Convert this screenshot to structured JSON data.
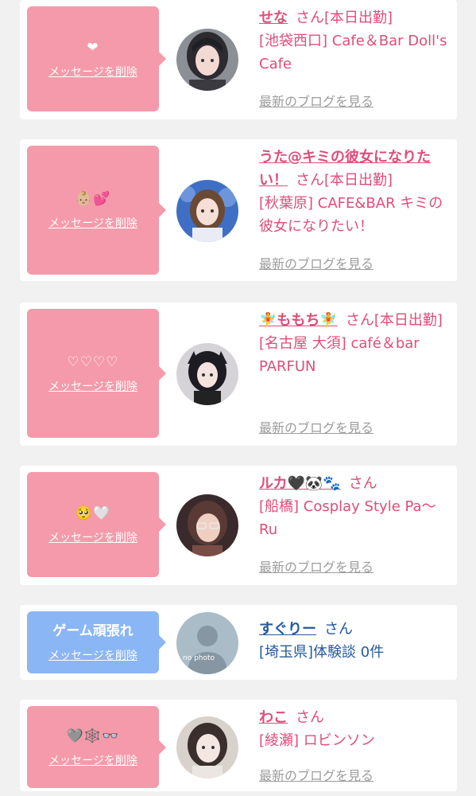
{
  "messages": [
    {
      "message": "❤",
      "delete_label": "メッセージを削除",
      "avatar": "girl-photo-1",
      "name": "せな",
      "suffix": "さん[本日出勤]",
      "shop": "[池袋西口] Cafe＆Bar Doll's Cafe",
      "blog_label": "最新のブログを見る"
    },
    {
      "message": "👶🏼💕",
      "delete_label": "メッセージを削除",
      "avatar": "girl-photo-2",
      "name": "うた@キミの彼女になりたい！",
      "suffix": "さん[本日出勤]",
      "shop": "[秋葉原] CAFE&BAR キミの彼女になりたい！",
      "blog_label": "最新のブログを見る"
    },
    {
      "message": "♡♡♡♡",
      "delete_label": "メッセージを削除",
      "avatar": "girl-photo-3",
      "name": "🧚ももち🧚",
      "suffix": "さん[本日出勤]",
      "shop": "[名古屋 大須] café＆bar PARFUN",
      "blog_label": "最新のブログを見る"
    },
    {
      "message": "🥺🤍",
      "delete_label": "メッセージを削除",
      "avatar": "girl-photo-4",
      "name": "ルカ🖤🐼🐾",
      "suffix": "さん",
      "shop": "[船橋] Cosplay Style Pa～Ru",
      "blog_label": "最新のブログを見る"
    },
    {
      "message": "ゲーム頑張れ",
      "delete_label": "メッセージを削除",
      "avatar": "no-photo-placeholder",
      "avatar_text": "no photo",
      "name": "すぐりー",
      "suffix": "さん",
      "shop": "[埼玉県]体験談 0件"
    },
    {
      "message": "🩶🕸️👓",
      "delete_label": "メッセージを削除",
      "avatar": "girl-photo-6",
      "name": "わこ",
      "suffix": "さん",
      "shop": "[綾瀬] ロビンソン",
      "blog_label": "最新のブログを見る"
    }
  ],
  "colors": {
    "pink_bubble": "#f59aaa",
    "blue_bubble": "#8ab6f5",
    "pink_text": "#de4e78",
    "blue_text": "#245a9c",
    "blog_link": "#9c9c9c"
  }
}
